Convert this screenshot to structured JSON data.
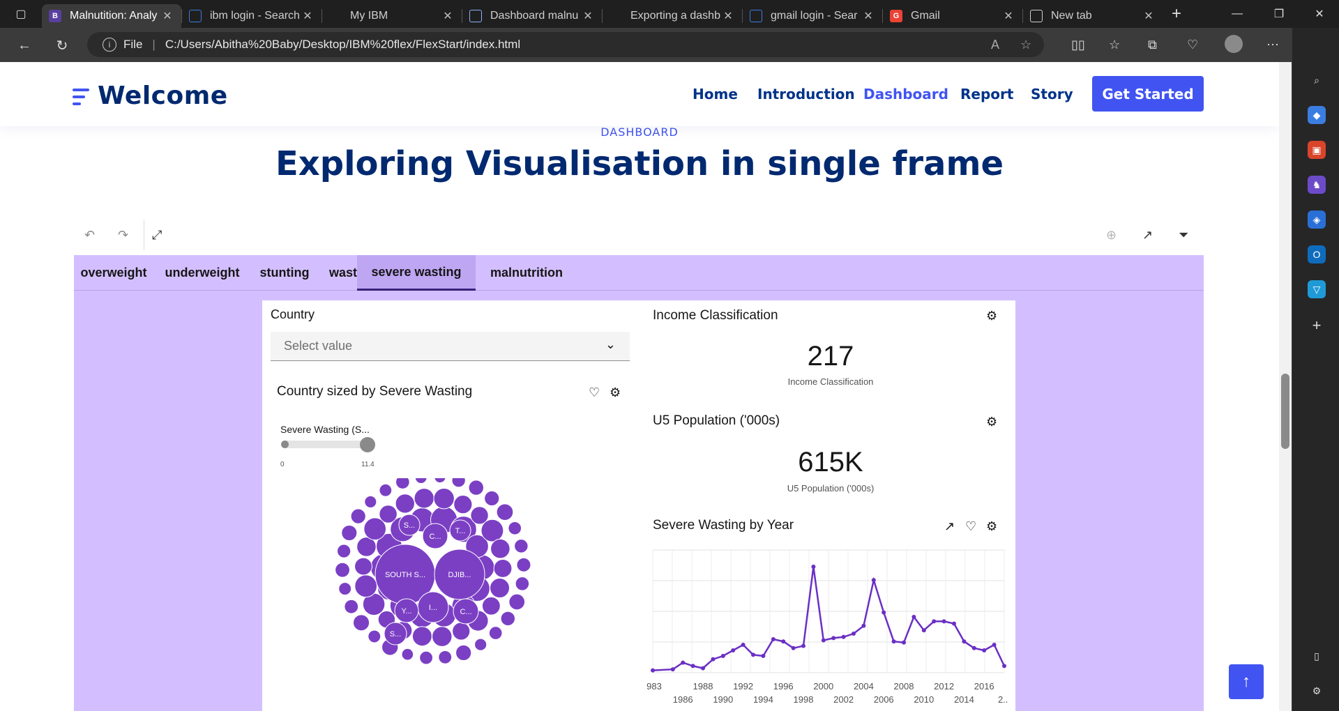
{
  "browser": {
    "tabs": [
      {
        "title": "Malnutition: Analy",
        "active": true,
        "favicon": "B",
        "favicon_color": "#5b3fa0"
      },
      {
        "title": "ibm login - Search",
        "active": false,
        "favicon": "search-icon",
        "favicon_color": "#3b7de0"
      },
      {
        "title": "My IBM",
        "active": false,
        "favicon": "ibm-icon",
        "favicon_color": "#1f1f1f"
      },
      {
        "title": "Dashboard malnu",
        "active": false,
        "favicon": "cognos-icon",
        "favicon_color": "#8ab4f8"
      },
      {
        "title": "Exporting a dashb",
        "active": false,
        "favicon": "ibm-icon",
        "favicon_color": "#1f1f1f"
      },
      {
        "title": "gmail login - Sear",
        "active": false,
        "favicon": "search-icon",
        "favicon_color": "#3b7de0"
      },
      {
        "title": "Gmail",
        "active": false,
        "favicon": "G",
        "favicon_color": "#ea4335"
      },
      {
        "title": "New tab",
        "active": false,
        "favicon": "newtab-icon",
        "favicon_color": "#cfcfcf"
      }
    ],
    "address": {
      "scheme_label": "File",
      "url": "C:/Users/Abitha%20Baby/Desktop/IBM%20flex/FlexStart/index.html"
    }
  },
  "site": {
    "logo": "Welcome",
    "nav": [
      "Home",
      "Introduction",
      "Dashboard",
      "Report",
      "Story"
    ],
    "nav_active": "Dashboard",
    "cta": "Get Started",
    "brand_color": "#4154f1",
    "heading_color": "#012970"
  },
  "section": {
    "label": "DASHBOARD",
    "title": "Exploring Visualisation in single frame"
  },
  "dashboard": {
    "tabs": [
      "overweight",
      "underweight",
      "stunting",
      "wasting",
      "severe wasting",
      "malnutrition"
    ],
    "active_tab": "severe wasting",
    "background": "#d3bfff",
    "country_filter": {
      "label": "Country",
      "placeholder": "Select value"
    },
    "income_kpi": {
      "title": "Income Classification",
      "value": "217",
      "caption": "Income Classification"
    },
    "population_kpi": {
      "title": "U5 Population ('000s)",
      "value": "615K",
      "caption": "U5 Population ('000s)"
    },
    "bubble_chart": {
      "title": "Country sized by Severe Wasting",
      "slider_label": "Severe Wasting (S...",
      "slider_min": "0",
      "slider_max": "11.4",
      "bubble_labels": [
        "SOUTH S...",
        "DJIB...",
        "S...",
        "C...",
        "T...",
        "I...",
        "Y...",
        "S...",
        "C..."
      ],
      "color": "#7b3fc4"
    },
    "line_chart_title": "Severe Wasting by Year"
  },
  "chart_data": {
    "type": "line",
    "title": "Severe Wasting by Year",
    "x_tick_labels_top": [
      "983",
      "1988",
      "1992",
      "1996",
      "2000",
      "2004",
      "2008",
      "2012",
      "2016"
    ],
    "x_tick_labels_bottom": [
      "1986",
      "1990",
      "1994",
      "1998",
      "2002",
      "2006",
      "2010",
      "2014",
      "2..."
    ],
    "x": [
      1983,
      1985,
      1986,
      1987,
      1988,
      1989,
      1990,
      1991,
      1992,
      1993,
      1994,
      1995,
      1996,
      1997,
      1998,
      1999,
      2000,
      2001,
      2002,
      2003,
      2004,
      2005,
      2006,
      2007,
      2008,
      2009,
      2010,
      2011,
      2012,
      2013,
      2014,
      2015,
      2016,
      2017,
      2018
    ],
    "values": [
      0.2,
      0.3,
      0.9,
      0.6,
      0.4,
      1.2,
      1.5,
      2.0,
      2.5,
      1.6,
      1.5,
      3.0,
      2.8,
      2.2,
      2.4,
      9.5,
      2.9,
      3.1,
      3.2,
      3.5,
      4.2,
      8.3,
      5.4,
      2.8,
      2.7,
      5.0,
      3.8,
      4.6,
      4.6,
      4.4,
      2.8,
      2.2,
      2.0,
      2.5,
      0.6
    ],
    "ylim": [
      0,
      11
    ],
    "grid": true,
    "color": "#6a2fc4"
  }
}
